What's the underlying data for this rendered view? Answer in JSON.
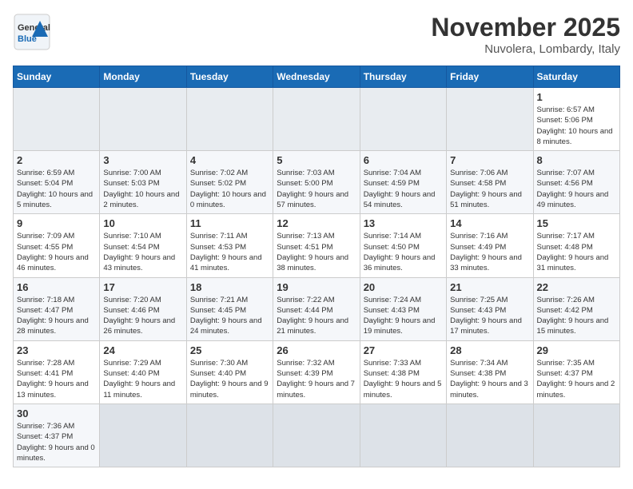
{
  "header": {
    "logo_general": "General",
    "logo_blue": "Blue",
    "month_title": "November 2025",
    "location": "Nuvolera, Lombardy, Italy"
  },
  "weekdays": [
    "Sunday",
    "Monday",
    "Tuesday",
    "Wednesday",
    "Thursday",
    "Friday",
    "Saturday"
  ],
  "weeks": [
    [
      {
        "day": "",
        "info": ""
      },
      {
        "day": "",
        "info": ""
      },
      {
        "day": "",
        "info": ""
      },
      {
        "day": "",
        "info": ""
      },
      {
        "day": "",
        "info": ""
      },
      {
        "day": "",
        "info": ""
      },
      {
        "day": "1",
        "info": "Sunrise: 6:57 AM\nSunset: 5:06 PM\nDaylight: 10 hours\nand 8 minutes."
      }
    ],
    [
      {
        "day": "2",
        "info": "Sunrise: 6:59 AM\nSunset: 5:04 PM\nDaylight: 10 hours\nand 5 minutes."
      },
      {
        "day": "3",
        "info": "Sunrise: 7:00 AM\nSunset: 5:03 PM\nDaylight: 10 hours\nand 2 minutes."
      },
      {
        "day": "4",
        "info": "Sunrise: 7:02 AM\nSunset: 5:02 PM\nDaylight: 10 hours\nand 0 minutes."
      },
      {
        "day": "5",
        "info": "Sunrise: 7:03 AM\nSunset: 5:00 PM\nDaylight: 9 hours\nand 57 minutes."
      },
      {
        "day": "6",
        "info": "Sunrise: 7:04 AM\nSunset: 4:59 PM\nDaylight: 9 hours\nand 54 minutes."
      },
      {
        "day": "7",
        "info": "Sunrise: 7:06 AM\nSunset: 4:58 PM\nDaylight: 9 hours\nand 51 minutes."
      },
      {
        "day": "8",
        "info": "Sunrise: 7:07 AM\nSunset: 4:56 PM\nDaylight: 9 hours\nand 49 minutes."
      }
    ],
    [
      {
        "day": "9",
        "info": "Sunrise: 7:09 AM\nSunset: 4:55 PM\nDaylight: 9 hours\nand 46 minutes."
      },
      {
        "day": "10",
        "info": "Sunrise: 7:10 AM\nSunset: 4:54 PM\nDaylight: 9 hours\nand 43 minutes."
      },
      {
        "day": "11",
        "info": "Sunrise: 7:11 AM\nSunset: 4:53 PM\nDaylight: 9 hours\nand 41 minutes."
      },
      {
        "day": "12",
        "info": "Sunrise: 7:13 AM\nSunset: 4:51 PM\nDaylight: 9 hours\nand 38 minutes."
      },
      {
        "day": "13",
        "info": "Sunrise: 7:14 AM\nSunset: 4:50 PM\nDaylight: 9 hours\nand 36 minutes."
      },
      {
        "day": "14",
        "info": "Sunrise: 7:16 AM\nSunset: 4:49 PM\nDaylight: 9 hours\nand 33 minutes."
      },
      {
        "day": "15",
        "info": "Sunrise: 7:17 AM\nSunset: 4:48 PM\nDaylight: 9 hours\nand 31 minutes."
      }
    ],
    [
      {
        "day": "16",
        "info": "Sunrise: 7:18 AM\nSunset: 4:47 PM\nDaylight: 9 hours\nand 28 minutes."
      },
      {
        "day": "17",
        "info": "Sunrise: 7:20 AM\nSunset: 4:46 PM\nDaylight: 9 hours\nand 26 minutes."
      },
      {
        "day": "18",
        "info": "Sunrise: 7:21 AM\nSunset: 4:45 PM\nDaylight: 9 hours\nand 24 minutes."
      },
      {
        "day": "19",
        "info": "Sunrise: 7:22 AM\nSunset: 4:44 PM\nDaylight: 9 hours\nand 21 minutes."
      },
      {
        "day": "20",
        "info": "Sunrise: 7:24 AM\nSunset: 4:43 PM\nDaylight: 9 hours\nand 19 minutes."
      },
      {
        "day": "21",
        "info": "Sunrise: 7:25 AM\nSunset: 4:43 PM\nDaylight: 9 hours\nand 17 minutes."
      },
      {
        "day": "22",
        "info": "Sunrise: 7:26 AM\nSunset: 4:42 PM\nDaylight: 9 hours\nand 15 minutes."
      }
    ],
    [
      {
        "day": "23",
        "info": "Sunrise: 7:28 AM\nSunset: 4:41 PM\nDaylight: 9 hours\nand 13 minutes."
      },
      {
        "day": "24",
        "info": "Sunrise: 7:29 AM\nSunset: 4:40 PM\nDaylight: 9 hours\nand 11 minutes."
      },
      {
        "day": "25",
        "info": "Sunrise: 7:30 AM\nSunset: 4:40 PM\nDaylight: 9 hours\nand 9 minutes."
      },
      {
        "day": "26",
        "info": "Sunrise: 7:32 AM\nSunset: 4:39 PM\nDaylight: 9 hours\nand 7 minutes."
      },
      {
        "day": "27",
        "info": "Sunrise: 7:33 AM\nSunset: 4:38 PM\nDaylight: 9 hours\nand 5 minutes."
      },
      {
        "day": "28",
        "info": "Sunrise: 7:34 AM\nSunset: 4:38 PM\nDaylight: 9 hours\nand 3 minutes."
      },
      {
        "day": "29",
        "info": "Sunrise: 7:35 AM\nSunset: 4:37 PM\nDaylight: 9 hours\nand 2 minutes."
      }
    ],
    [
      {
        "day": "30",
        "info": "Sunrise: 7:36 AM\nSunset: 4:37 PM\nDaylight: 9 hours\nand 0 minutes."
      },
      {
        "day": "",
        "info": ""
      },
      {
        "day": "",
        "info": ""
      },
      {
        "day": "",
        "info": ""
      },
      {
        "day": "",
        "info": ""
      },
      {
        "day": "",
        "info": ""
      },
      {
        "day": "",
        "info": ""
      }
    ]
  ]
}
